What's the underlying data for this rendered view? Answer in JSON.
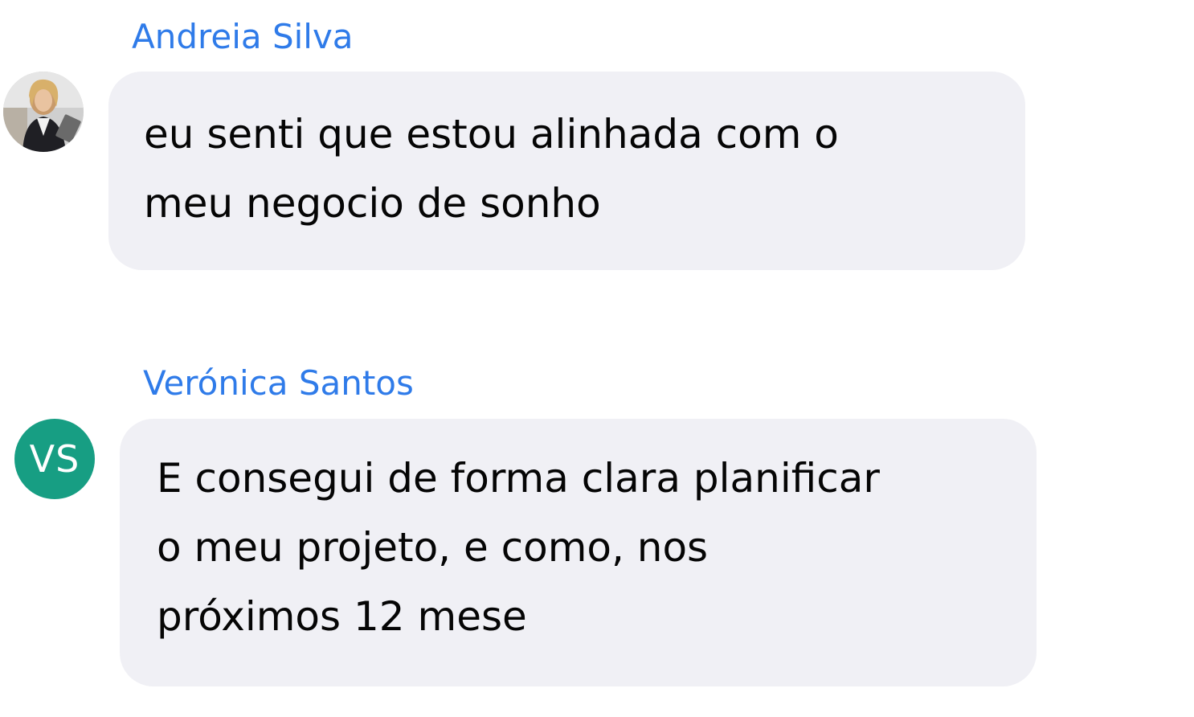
{
  "messages": [
    {
      "sender": "Andreia Silva",
      "avatar": {
        "type": "photo",
        "icon": "user-photo-icon"
      },
      "text": "eu senti que estou alinhada com o\nmeu negocio de sonho"
    },
    {
      "sender": "Verónica Santos",
      "avatar": {
        "type": "initials",
        "initials": "VS",
        "color": "#179e83"
      },
      "text": "E consegui de forma clara planificar\no meu projeto, e como, nos\npróximos 12 mese"
    }
  ],
  "colors": {
    "sender_name": "#2f7be9",
    "bubble_background": "#f0f0f5",
    "message_text": "#050505"
  }
}
